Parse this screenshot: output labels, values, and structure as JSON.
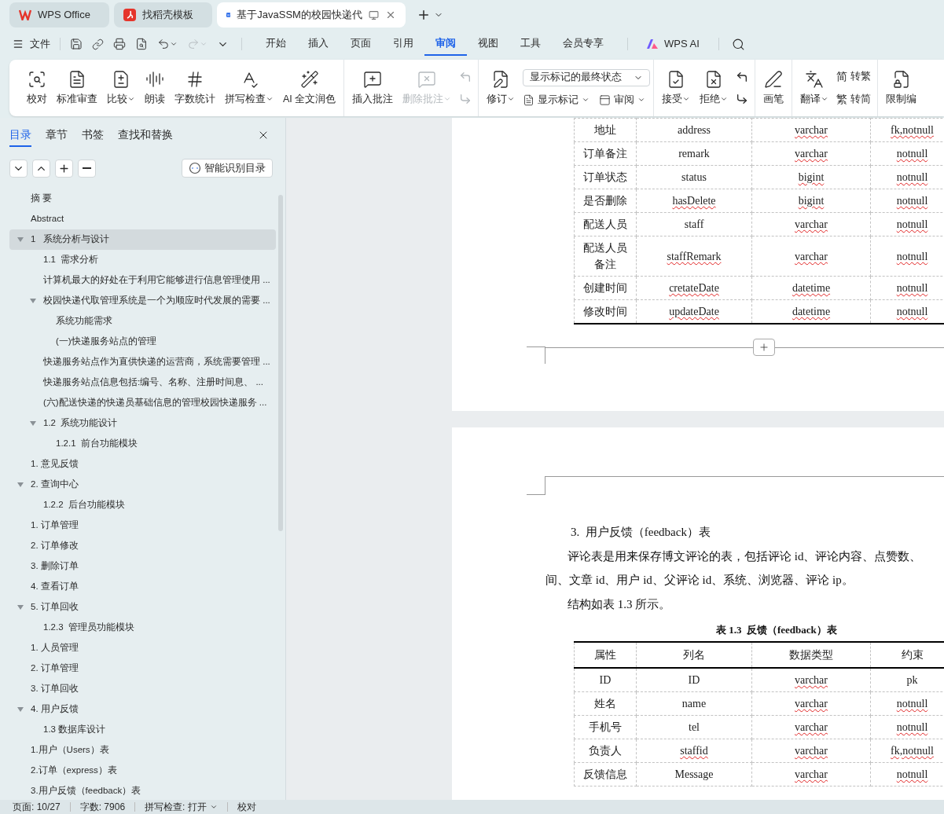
{
  "window_tabs": [
    {
      "label": "WPS Office",
      "kind": "home",
      "selected": false
    },
    {
      "label": "找稻壳模板",
      "kind": "template",
      "selected": false
    },
    {
      "label": "基于JavaSSM的校园快递代",
      "kind": "doc",
      "selected": true
    }
  ],
  "menu": {
    "file": "文件",
    "tabs": [
      {
        "label": "开始",
        "selected": false
      },
      {
        "label": "插入",
        "selected": false
      },
      {
        "label": "页面",
        "selected": false
      },
      {
        "label": "引用",
        "selected": false
      },
      {
        "label": "审阅",
        "selected": true
      },
      {
        "label": "视图",
        "selected": false
      },
      {
        "label": "工具",
        "selected": false
      },
      {
        "label": "会员专享",
        "selected": false
      }
    ],
    "ai": "WPS AI"
  },
  "ribbon": {
    "proof": [
      {
        "label": "校对",
        "caret": false
      },
      {
        "label": "标准审查",
        "caret": false
      },
      {
        "label": "比较",
        "caret": true
      },
      {
        "label": "朗读",
        "caret": false
      },
      {
        "label": "字数统计",
        "caret": false
      },
      {
        "label": "拼写检查",
        "caret": true
      },
      {
        "label": "AI 全文润色",
        "caret": false
      }
    ],
    "comments": [
      {
        "label": "插入批注",
        "caret": false,
        "disabled": false
      },
      {
        "label": "删除批注",
        "caret": true,
        "disabled": true
      }
    ],
    "markup_select": "显示标记的最终状态",
    "track": "修订",
    "show_markup": "显示标记",
    "review": "审阅",
    "accept": "接受",
    "reject": "拒绝",
    "pen": "画笔",
    "translate": "翻译",
    "convert": [
      {
        "glyph": "简",
        "label": "转繁"
      },
      {
        "glyph": "繁",
        "label": "转简"
      }
    ],
    "restrict": "限制编"
  },
  "nav": {
    "tabs": [
      {
        "label": "目录",
        "selected": true
      },
      {
        "label": "章节",
        "selected": false
      },
      {
        "label": "书签",
        "selected": false
      },
      {
        "label": "查找和替换",
        "selected": false
      }
    ],
    "smart_button": "智能识别目录",
    "tree": [
      {
        "label": "摘 要",
        "selected": false
      },
      {
        "label": "Abstract",
        "selected": false
      },
      {
        "label": "1   系统分析与设计",
        "selected": true,
        "expanded": true,
        "children": [
          {
            "label": "1.1  需求分析",
            "selected": false
          },
          {
            "label": "计算机最大的好处在于利用它能够进行信息管理使用 ...",
            "selected": false
          },
          {
            "label": "校园快递代取管理系统是一个为顺应时代发展的需要 ...",
            "selected": false,
            "expanded": true,
            "children": [
              {
                "label": "系统功能需求",
                "selected": false
              },
              {
                "label": "(一)快递服务站点的管理",
                "selected": false
              }
            ]
          },
          {
            "label": "快递服务站点作为直供快递的运营商，系统需要管理 ...",
            "selected": false
          },
          {
            "label": "快递服务站点信息包括:编号、名称、注册时间息、 ...",
            "selected": false
          },
          {
            "label": "(六)配送快递的快递员基础信息的管理校园快递服务 ...",
            "selected": false
          },
          {
            "label": "1.2  系统功能设计",
            "selected": false,
            "expanded": true,
            "children": [
              {
                "label": "1.2.1  前台功能模块",
                "selected": false
              }
            ]
          }
        ]
      },
      {
        "label": "1. 意见反馈",
        "selected": false
      },
      {
        "label": "2. 查询中心",
        "selected": false,
        "expanded": true,
        "children": [
          {
            "label": "1.2.2  后台功能模块",
            "selected": false
          }
        ]
      },
      {
        "label": "1. 订单管理",
        "selected": false
      },
      {
        "label": "2. 订单修改",
        "selected": false
      },
      {
        "label": "3. 删除订单",
        "selected": false
      },
      {
        "label": "4. 查看订单",
        "selected": false
      },
      {
        "label": "5. 订单回收",
        "selected": false,
        "expanded": true,
        "children": [
          {
            "label": "1.2.3  管理员功能模块",
            "selected": false
          }
        ]
      },
      {
        "label": "1. 人员管理",
        "selected": false
      },
      {
        "label": "2. 订单管理",
        "selected": false
      },
      {
        "label": "3. 订单回收",
        "selected": false
      },
      {
        "label": "4. 用户反馈",
        "selected": false,
        "expanded": true,
        "children": [
          {
            "label": "1.3 数据库设计",
            "selected": false
          }
        ]
      },
      {
        "label": "1.用户（Users）表",
        "selected": false
      },
      {
        "label": "2.订单（express）表",
        "selected": false
      },
      {
        "label": "3.用户反馈（feedback）表",
        "selected": false
      }
    ]
  },
  "document": {
    "table_1": {
      "rows": [
        [
          {
            "text": "地址",
            "misspelled": false
          },
          {
            "text": "address",
            "misspelled": false
          },
          {
            "text": "varchar",
            "misspelled": true
          },
          {
            "text": "fk,notnull",
            "misspelled": true
          }
        ],
        [
          {
            "text": "订单备注",
            "misspelled": false
          },
          {
            "text": "remark",
            "misspelled": false
          },
          {
            "text": "varchar",
            "misspelled": true
          },
          {
            "text": "notnull",
            "misspelled": true
          }
        ],
        [
          {
            "text": "订单状态",
            "misspelled": false
          },
          {
            "text": "status",
            "misspelled": false
          },
          {
            "text": "bigint",
            "misspelled": true
          },
          {
            "text": "notnull",
            "misspelled": true
          }
        ],
        [
          {
            "text": "是否删除",
            "misspelled": false
          },
          {
            "text": "hasDelete",
            "misspelled": true
          },
          {
            "text": "bigint",
            "misspelled": true
          },
          {
            "text": "notnull",
            "misspelled": true
          }
        ],
        [
          {
            "text": "配送人员",
            "misspelled": false
          },
          {
            "text": "staff",
            "misspelled": false
          },
          {
            "text": "varchar",
            "misspelled": true
          },
          {
            "text": "notnull",
            "misspelled": true
          }
        ],
        [
          {
            "text": "配送人员备注",
            "misspelled": false
          },
          {
            "text": "staffRemark",
            "misspelled": true
          },
          {
            "text": "varchar",
            "misspelled": true
          },
          {
            "text": "notnull",
            "misspelled": true
          }
        ],
        [
          {
            "text": "创建时间",
            "misspelled": false
          },
          {
            "text": "cretateDate",
            "misspelled": true
          },
          {
            "text": "datetime",
            "misspelled": true
          },
          {
            "text": "notnull",
            "misspelled": true
          }
        ],
        [
          {
            "text": "修改时间",
            "misspelled": false
          },
          {
            "text": "updateDate",
            "misspelled": true
          },
          {
            "text": "datetime",
            "misspelled": true
          },
          {
            "text": "notnull",
            "misspelled": true
          }
        ]
      ]
    },
    "heading": "3.  用户反馈（feedback）表",
    "paragraph_lines": [
      "评论表是用来保存博文评论的表，包括评论 id、评论内容、点赞数、",
      "间、文章 id、用户 id、父评论 id、系统、浏览器、评论 ip。"
    ],
    "note": "结构如表 1.3 所示。",
    "table_2": {
      "caption": "表 1.3  反馈（feedback）表",
      "columns": [
        "属性",
        "列名",
        "数据类型",
        "约束"
      ],
      "rows": [
        [
          {
            "text": "ID",
            "misspelled": false
          },
          {
            "text": "ID",
            "misspelled": false
          },
          {
            "text": "varchar",
            "misspelled": true
          },
          {
            "text": "pk",
            "misspelled": false
          }
        ],
        [
          {
            "text": "姓名",
            "misspelled": false
          },
          {
            "text": "name",
            "misspelled": false
          },
          {
            "text": "varchar",
            "misspelled": true
          },
          {
            "text": "notnull",
            "misspelled": true
          }
        ],
        [
          {
            "text": "手机号",
            "misspelled": false
          },
          {
            "text": "tel",
            "misspelled": false
          },
          {
            "text": "varchar",
            "misspelled": true
          },
          {
            "text": "notnull",
            "misspelled": true
          }
        ],
        [
          {
            "text": "负责人",
            "misspelled": false
          },
          {
            "text": "staffid",
            "misspelled": true
          },
          {
            "text": "varchar",
            "misspelled": true
          },
          {
            "text": "fk,notnull",
            "misspelled": true
          }
        ],
        [
          {
            "text": "反馈信息",
            "misspelled": false
          },
          {
            "text": "Message",
            "misspelled": false
          },
          {
            "text": "varchar",
            "misspelled": true
          },
          {
            "text": "notnull",
            "misspelled": true
          }
        ]
      ]
    }
  },
  "status_bar": {
    "page": "页面: 10/27",
    "words": "字数: 7906",
    "spell": "拼写检查: 打开",
    "proof": "校对"
  }
}
